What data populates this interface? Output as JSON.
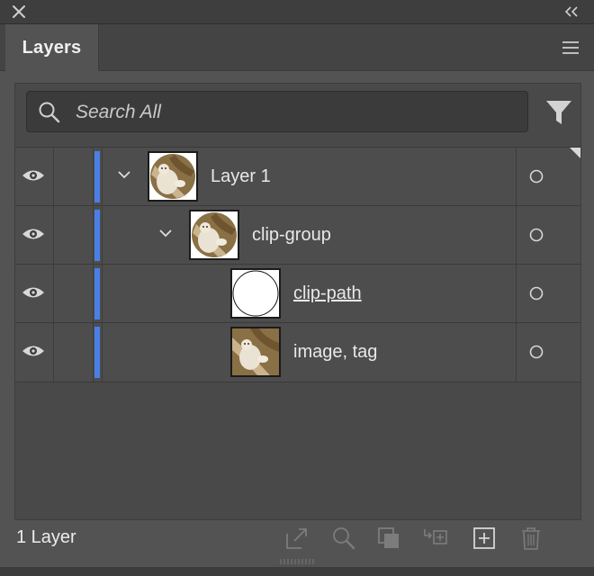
{
  "panel": {
    "tab_label": "Layers"
  },
  "search": {
    "placeholder": "Search All"
  },
  "layers": [
    {
      "name": "Layer 1",
      "expanded": true
    },
    {
      "name": "clip-group",
      "expanded": true
    },
    {
      "name": "clip-path"
    },
    {
      "name": "image, tag"
    }
  ],
  "footer": {
    "layer_count": "1 Layer"
  },
  "colors": {
    "layer_color_bar": "#4a7fe6",
    "panel_bg": "#535353"
  },
  "icons": [
    "close-icon",
    "collapse-panel-icon",
    "panel-menu-icon",
    "search-icon",
    "filter-icon",
    "eye-icon",
    "chevron-down-icon",
    "target-circle-icon",
    "collect-in-new-layer-icon",
    "locate-object-icon",
    "make-clipping-mask-icon",
    "create-sublayer-icon",
    "new-layer-icon",
    "delete-icon"
  ]
}
